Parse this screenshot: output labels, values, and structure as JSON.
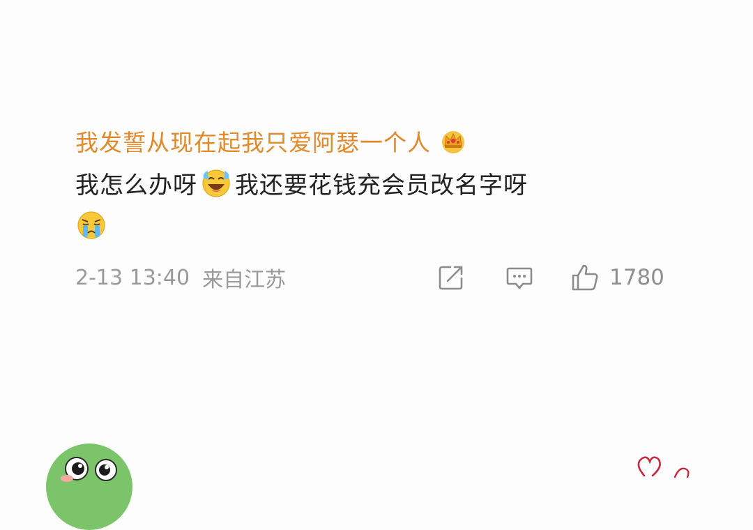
{
  "comment": {
    "username": "我发誓从现在起我只爱阿瑟一个人",
    "username_badge_icon": "crown-icon",
    "text_part1": "我怎么办呀",
    "inline_emoji": "laughing-crying-emoji",
    "text_part2": "我还要花钱充会员改名字呀",
    "trailing_emoji": "crying-emoji",
    "timestamp": "2-13 13:40",
    "location": "来自江苏",
    "like_count": "1780"
  },
  "actions": {
    "share_icon": "share-icon",
    "reply_icon": "comment-icon",
    "like_icon": "thumbs-up-icon"
  },
  "colors": {
    "username": "#e08a2c",
    "body_text": "#222222",
    "meta_text": "#9a9a9a",
    "background": "#fdfdfd"
  }
}
